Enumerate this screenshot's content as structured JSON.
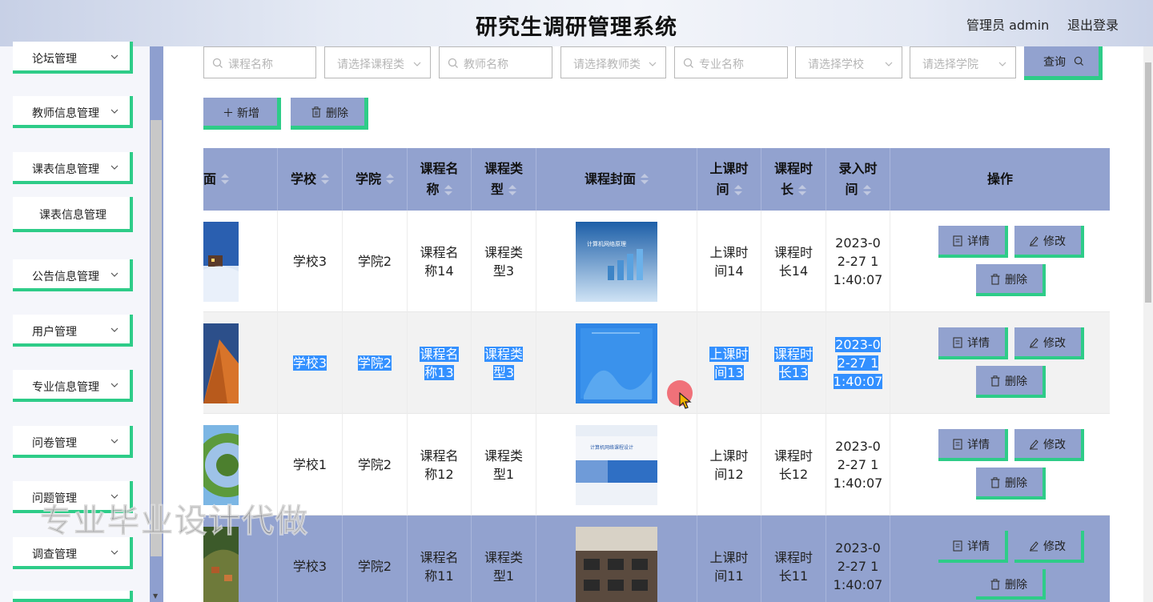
{
  "header": {
    "title": "研究生调研管理系统",
    "admin_label": "管理员 admin",
    "logout_label": "退出登录"
  },
  "sidebar": {
    "items": [
      {
        "label": "论坛管理"
      },
      {
        "label": "教师信息管理"
      },
      {
        "label": "课表信息管理"
      },
      {
        "label": "课表信息管理"
      },
      {
        "label": "公告信息管理"
      },
      {
        "label": "用户管理"
      },
      {
        "label": "专业信息管理"
      },
      {
        "label": "问卷管理"
      },
      {
        "label": "问题管理"
      },
      {
        "label": "调查管理"
      }
    ]
  },
  "search": {
    "course_name": "课程名称",
    "course_type": "请选择课程类",
    "teacher_name": "教师名称",
    "teacher_type": "请选择教师类",
    "major_name": "专业名称",
    "school": "请选择学校",
    "college": "请选择学院",
    "query_label": "查询"
  },
  "toolbar": {
    "add_label": "新增",
    "delete_label": "删除"
  },
  "table": {
    "headers": {
      "cover_partial": "面",
      "school": "学校",
      "college": "学院",
      "course_name_1": "课程名",
      "course_name_2": "称",
      "course_type_1": "课程类",
      "course_type_2": "型",
      "course_cover": "课程封面",
      "class_time_1": "上课时",
      "class_time_2": "间",
      "duration_1": "课程时",
      "duration_2": "长",
      "entry_time_1": "录入时",
      "entry_time_2": "间",
      "actions": "操作"
    },
    "rows": [
      {
        "school": "学校3",
        "college": "学院2",
        "name1": "课程名",
        "name2": "称14",
        "type1": "课程类",
        "type2": "型3",
        "time1": "上课时",
        "time2": "间14",
        "dur1": "课程时",
        "dur2": "长14",
        "e1": "2023-0",
        "e2": "2-27 1",
        "e3": "1:40:07",
        "cover_text": "计算机网络原理",
        "selected": false
      },
      {
        "school": "学校3",
        "college": "学院2",
        "name1": "课程名",
        "name2": "称13",
        "type1": "课程类",
        "type2": "型3",
        "time1": "上课时",
        "time2": "间13",
        "dur1": "课程时",
        "dur2": "长13",
        "e1": "2023-0",
        "e2": "2-27 1",
        "e3": "1:40:07",
        "cover_text": "",
        "selected": true
      },
      {
        "school": "学校1",
        "college": "学院2",
        "name1": "课程名",
        "name2": "称12",
        "type1": "课程类",
        "type2": "型1",
        "time1": "上课时",
        "time2": "间12",
        "dur1": "课程时",
        "dur2": "长12",
        "e1": "2023-0",
        "e2": "2-27 1",
        "e3": "1:40:07",
        "cover_text": "计算机网络课程设计",
        "selected": false
      },
      {
        "school": "学校3",
        "college": "学院2",
        "name1": "课程名",
        "name2": "称11",
        "type1": "课程类",
        "type2": "型1",
        "time1": "上课时",
        "time2": "间11",
        "dur1": "课程时",
        "dur2": "长11",
        "e1": "2023-0",
        "e2": "2-27 1",
        "e3": "1:40:07",
        "cover_text": "",
        "selected": false
      }
    ],
    "action_labels": {
      "detail": "详情",
      "edit": "修改",
      "delete": "删除"
    }
  },
  "watermark": "专业毕业设计代做",
  "colors": {
    "accent_green": "#2ecc88",
    "header_blue": "#92a2cf",
    "selection": "#3390ff"
  }
}
